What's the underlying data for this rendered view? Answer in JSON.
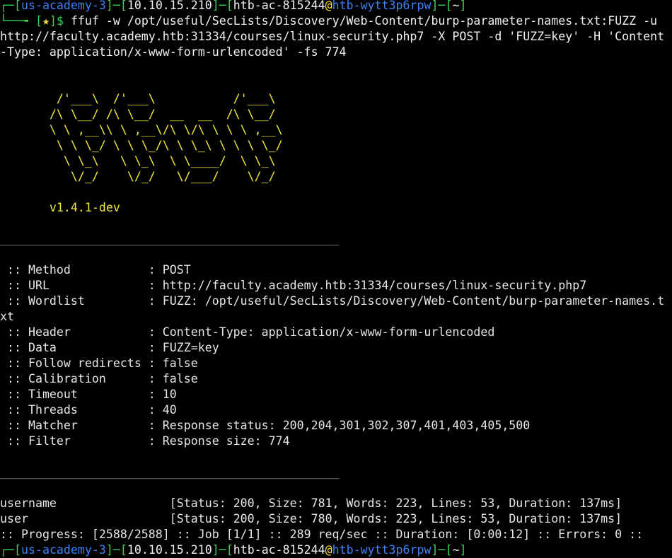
{
  "colors": {
    "prompt_frame": "#39d353",
    "prompt_user": "#3b82f6",
    "prompt_text": "#f0f0f0",
    "banner": "#f2e83a",
    "separator": "#9aa3b0",
    "output": "#e6e6e6"
  },
  "prompt": {
    "box_top": "┌─[",
    "user": "us-academy-3",
    "sep1": "]─[",
    "ip": "10.10.15.210",
    "sep2": "]─[",
    "host_user": "htb-ac-815244",
    "at": "@",
    "host": "htb-wytt3p6rpw",
    "sep3": "]─[",
    "cwd": "~",
    "end": "]",
    "box_bottom": "└──╼ [",
    "star": "★",
    "dollar": "]$ ",
    "command_line1": "ffuf -w /opt/useful/SecLists/Discovery/Web-Content/burp-parameter-names.txt:FUZZ -u",
    "command_line2": "http://faculty.academy.htb:31334/courses/linux-security.php7 -X POST -d 'FUZZ=key' -H 'Content",
    "command_line3": "-Type: application/x-www-form-urlencoded' -fs 774"
  },
  "banner": {
    "art": [
      "        /'___\\  /'___\\           /'___\\       ",
      "       /\\ \\__/ /\\ \\__/  __  __  /\\ \\__/       ",
      "       \\ \\ ,__\\\\ \\ ,__\\/\\ \\/\\ \\ \\ \\ ,__\\      ",
      "        \\ \\ \\_/ \\ \\ \\_/\\ \\ \\_\\ \\ \\ \\ \\_/      ",
      "         \\ \\_\\   \\ \\_\\  \\ \\____/  \\ \\_\\       ",
      "          \\/_/    \\/_/   \\/___/    \\/_/       "
    ],
    "version": "       v1.4.1-dev"
  },
  "separator": "________________________________________________",
  "config": [
    {
      "label": " :: Method           : ",
      "value": "POST"
    },
    {
      "label": " :: URL              : ",
      "value": "http://faculty.academy.htb:31334/courses/linux-security.php7"
    },
    {
      "label": " :: Wordlist         : ",
      "value": "FUZZ: /opt/useful/SecLists/Discovery/Web-Content/burp-parameter-names.t"
    },
    {
      "label": "",
      "value": "xt"
    },
    {
      "label": " :: Header           : ",
      "value": "Content-Type: application/x-www-form-urlencoded"
    },
    {
      "label": " :: Data             : ",
      "value": "FUZZ=key"
    },
    {
      "label": " :: Follow redirects : ",
      "value": "false"
    },
    {
      "label": " :: Calibration      : ",
      "value": "false"
    },
    {
      "label": " :: Timeout          : ",
      "value": "10"
    },
    {
      "label": " :: Threads          : ",
      "value": "40"
    },
    {
      "label": " :: Matcher          : ",
      "value": "Response status: 200,204,301,302,307,401,403,405,500"
    },
    {
      "label": " :: Filter           : ",
      "value": "Response size: 774"
    }
  ],
  "results": [
    {
      "name": "username                ",
      "detail": "[Status: 200, Size: 781, Words: 223, Lines: 53, Duration: 137ms]"
    },
    {
      "name": "user                    ",
      "detail": "[Status: 200, Size: 780, Words: 223, Lines: 53, Duration: 137ms]"
    }
  ],
  "progress": ":: Progress: [2588/2588] :: Job [1/1] :: 289 req/sec :: Duration: [0:00:12] :: Errors: 0 ::",
  "next_prompt": {
    "box_top": "┌─[",
    "user": "us-academy-3",
    "sep1": "]─[",
    "ip": "10.10.15.210",
    "sep2": "]─[",
    "host_user": "htb-ac-815244",
    "at": "@",
    "host": "htb-wytt3p6rpw",
    "sep3": "]─[",
    "cwd": "~",
    "end": "]"
  }
}
